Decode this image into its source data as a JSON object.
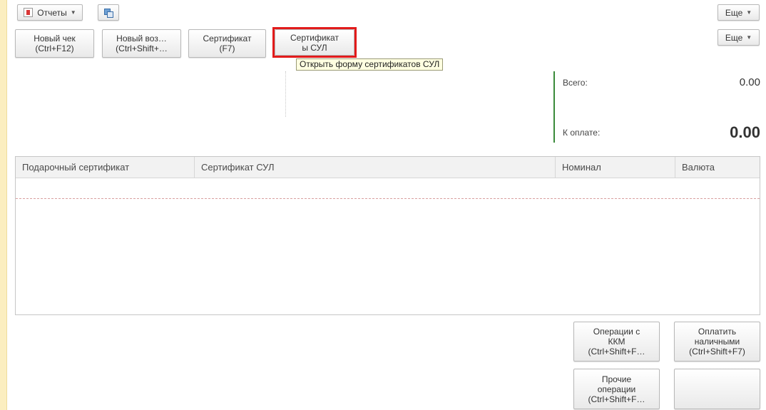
{
  "toolbar": {
    "reports_label": "Отчеты",
    "more_top_label": "Еще"
  },
  "commands": {
    "new_check": "Новый чек\n(Ctrl+F12)",
    "new_return": "Новый воз…\n(Ctrl+Shift+…",
    "certificate": "Сертификат\n(F7)",
    "certificates_sul": "Сертификат\nы СУЛ",
    "more_label": "Еще"
  },
  "tooltip": {
    "text": "Открыть форму сертификатов СУЛ"
  },
  "summary": {
    "total_label": "Всего:",
    "total_value": "0.00",
    "to_pay_label": "К оплате:",
    "to_pay_value": "0.00"
  },
  "table": {
    "columns": [
      "Подарочный сертификат",
      "Сертификат СУЛ",
      "Номинал",
      "Валюта"
    ],
    "rows": []
  },
  "bottom_buttons": {
    "kkm_operations": "Операции с\nККМ\n(Ctrl+Shift+F…",
    "pay_cash": "Оплатить\nналичными\n(Ctrl+Shift+F7)",
    "other_operations": "Прочие\nоперации\n(Ctrl+Shift+F…",
    "empty": ""
  },
  "colors": {
    "highlight": "#e21b1b",
    "accent_green": "#3a8a3a",
    "tooltip_bg": "#ffffe1",
    "left_strip": "#fbeec0"
  },
  "icons": {
    "reports": "report-document-icon",
    "windows": "windows-switch-icon",
    "dropdown": "chevron-down-icon"
  }
}
